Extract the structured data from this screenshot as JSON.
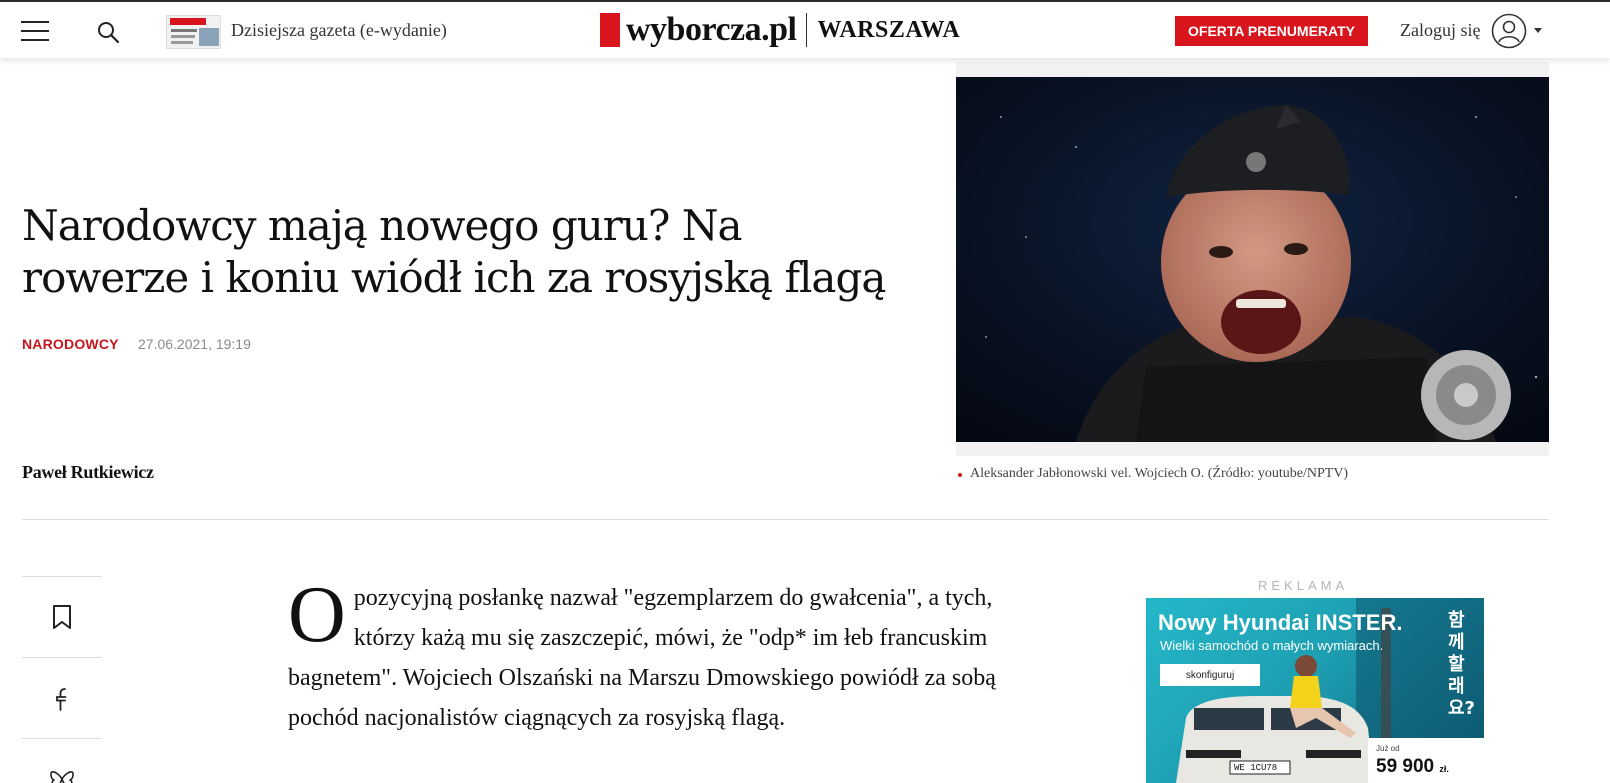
{
  "header": {
    "menu_label": "menu",
    "edition_link": "Dzisiejsza gazeta (e-wydanie)",
    "logo_text": "wyborcza.pl",
    "city": "WARSZAWA",
    "offer_button": "OFERTA PRENUMERATY",
    "login": "Zaloguj się"
  },
  "article": {
    "headline": "Narodowcy mają nowego guru? Na rowerze i koniu wiódł ich za rosyjską flagą",
    "section": "NARODOWCY",
    "date": "27.06.2021, 19:19",
    "author": "Paweł Rutkiewicz",
    "image_caption": "Aleksander Jabłonowski vel. Wojciech O. (Źródło: youtube/NPTV)",
    "lead_drop": "O",
    "lead": "pozycyjną posłankę nazwał \"egzemplarzem do gwałcenia\", a tych, którzy każą mu się zaszczepić, mówi, że \"odp* im łeb francuskim bagnetem\". Wojciech Olszański na Marszu Dmowskiego powiódł za sobą pochód nacjonalistów ciągnących za rosyjską flagą."
  },
  "share": {
    "icons": [
      "bookmark-icon",
      "facebook-icon",
      "bluesky-icon"
    ]
  },
  "ad": {
    "label": "REKLAMA",
    "title": "Nowy Hyundai INSTER.",
    "subtitle": "Wielki samochód o małych wymiarach.",
    "cta": "skonfiguruj",
    "korean": "함께할래요?",
    "price_from": "Już od",
    "price": "59 900",
    "price_unit": "zł.",
    "plate": "WE 1CU78"
  },
  "colors": {
    "brand_red": "#d8141c",
    "section_red": "#c4161c"
  }
}
